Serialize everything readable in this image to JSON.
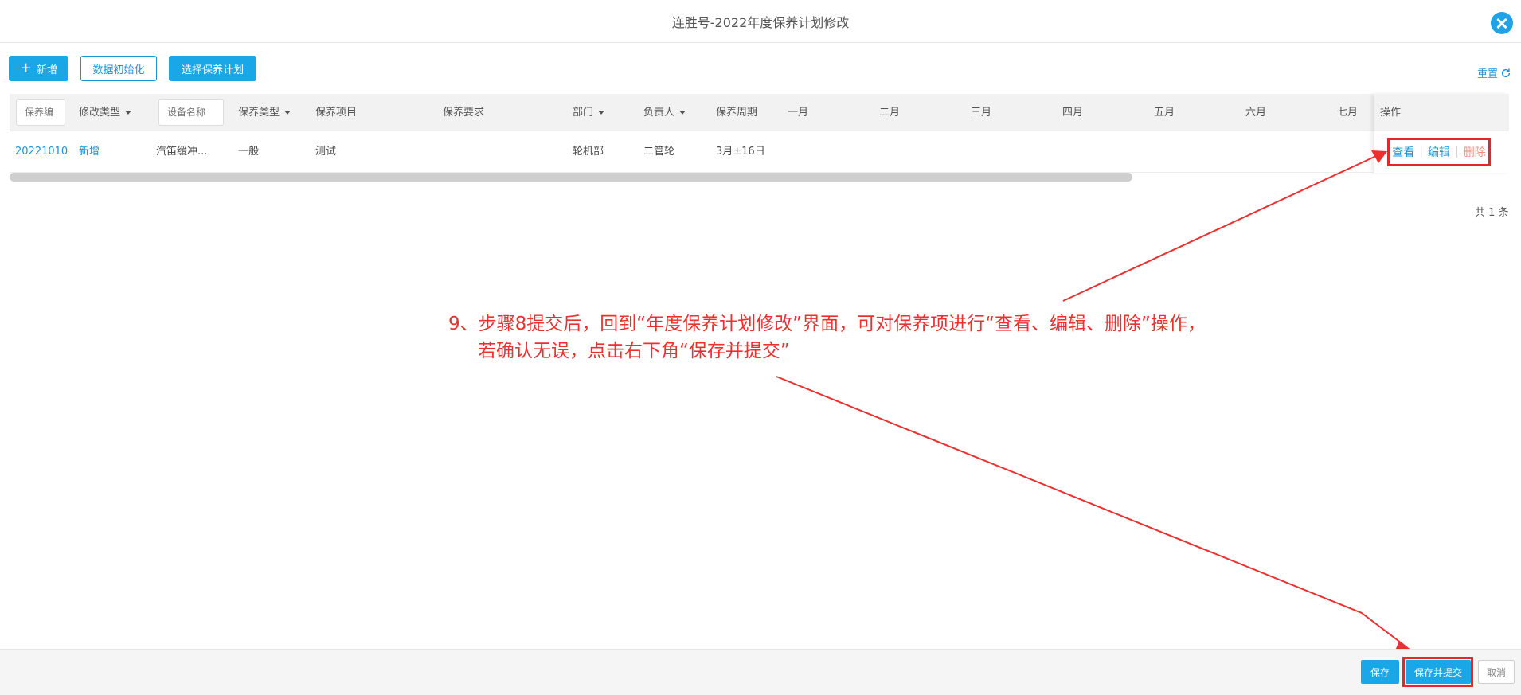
{
  "header": {
    "title": "连胜号-2022年度保养计划修改"
  },
  "toolbar": {
    "add_label": "新增",
    "init_label": "数据初始化",
    "select_plan_label": "选择保养计划",
    "reset_label": "重置"
  },
  "table": {
    "filters": {
      "code_placeholder": "保养编",
      "device_placeholder": "设备名称"
    },
    "headers": {
      "modify_type": "修改类型",
      "maint_type": "保养类型",
      "maint_item": "保养项目",
      "maint_req": "保养要求",
      "dept": "部门",
      "owner": "负责人",
      "cycle": "保养周期",
      "months": [
        "一月",
        "二月",
        "三月",
        "四月",
        "五月",
        "六月",
        "七月"
      ],
      "actions": "操作"
    },
    "rows": [
      {
        "code": "20221010",
        "modify_type": "新增",
        "device": "汽笛缓冲...",
        "maint_type": "一般",
        "maint_item": "测试",
        "dept": "轮机部",
        "owner": "二管轮",
        "cycle": "3月±16日",
        "actions": {
          "view": "查看",
          "edit": "编辑",
          "delete": "删除"
        }
      }
    ],
    "total_text": "共 1 条"
  },
  "annotation": {
    "line1": "9、步骤8提交后，回到“年度保养计划修改”界面，可对保养项进行“查看、编辑、删除”操作，",
    "line2": "若确认无误，点击右下角“保存并提交”"
  },
  "footer": {
    "save_label": "保存",
    "submit_label": "保存并提交",
    "cancel_label": "取消"
  },
  "colors": {
    "primary": "#1aa7e8",
    "link": "#1a93d6",
    "danger": "#f08a7a",
    "annotation": "#ec2f2f"
  }
}
